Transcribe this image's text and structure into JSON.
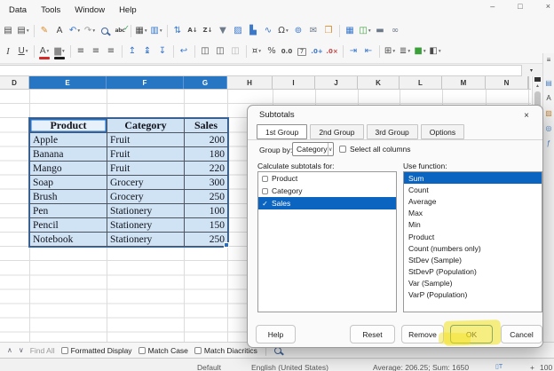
{
  "app": {
    "menu": [
      {
        "label": "Data"
      },
      {
        "label": "Tools"
      },
      {
        "label": "Window"
      },
      {
        "label": "Help"
      }
    ],
    "window_controls": [
      {
        "name": "minimize-button",
        "glyph": "–"
      },
      {
        "name": "maximize-button",
        "glyph": "□"
      },
      {
        "name": "close-button",
        "glyph": "×"
      }
    ]
  },
  "toolbar_main": [
    {
      "name": "copy-icon",
      "glyph": "▤"
    },
    {
      "name": "paste-icon",
      "glyph": "▤",
      "caret": true
    },
    {
      "sep": true
    },
    {
      "name": "clone-formatting-icon",
      "glyph": "✎",
      "color": "#d98b2b"
    },
    {
      "name": "clear-formatting-icon",
      "glyph": "A",
      "color": "#444"
    },
    {
      "name": "undo-icon",
      "glyph": "↶",
      "color": "#3b78c9",
      "caret": true
    },
    {
      "name": "redo-icon",
      "glyph": "↷",
      "color": "#9a9a9a",
      "caret": true
    },
    {
      "name": "find-replace-icon",
      "icon": "lens"
    },
    {
      "name": "spelling-icon",
      "glyph": "abc",
      "cls": "spell"
    },
    {
      "sep": true
    },
    {
      "name": "insert-row-icon",
      "glyph": "▦",
      "caret": true
    },
    {
      "name": "insert-column-icon",
      "glyph": "▥",
      "color": "#3b78c9",
      "caret": true
    },
    {
      "sep": true
    },
    {
      "name": "sort-icon",
      "glyph": "⇅",
      "color": "#3b78c9"
    },
    {
      "name": "sort-ascending-icon",
      "glyph": "A↓",
      "cls": "tiny"
    },
    {
      "name": "sort-descending-icon",
      "glyph": "Z↓",
      "cls": "tiny"
    },
    {
      "name": "autofilter-icon",
      "glyph": "▼",
      "color": "#6d7a8a"
    },
    {
      "name": "insert-image-icon",
      "glyph": "▨",
      "color": "#3b78c9"
    },
    {
      "name": "insert-chart-icon",
      "glyph": "▙",
      "color": "#3b78c9"
    },
    {
      "name": "sparkline-icon",
      "glyph": "∿",
      "color": "#3b78c9"
    },
    {
      "name": "special-character-icon",
      "glyph": "Ω",
      "caret": true
    },
    {
      "name": "hyperlink-icon",
      "glyph": "⊚",
      "color": "#3b78c9"
    },
    {
      "name": "comment-icon",
      "glyph": "✉",
      "color": "#6d7a8a"
    },
    {
      "name": "draft-page-icon",
      "glyph": "❒",
      "color": "#d98b2b"
    },
    {
      "sep": true
    },
    {
      "name": "pivot-table-icon",
      "glyph": "▦",
      "color": "#3b78c9"
    },
    {
      "name": "freeze-panes-icon",
      "glyph": "◫",
      "color": "#3aa13a",
      "caret": true
    },
    {
      "name": "split-window-icon",
      "glyph": "▬",
      "color": "#6d7a8a"
    },
    {
      "name": "shapes-icon",
      "glyph": "∞",
      "color": "#6d7a8a"
    }
  ],
  "toolbar_format": [
    {
      "name": "italic-icon",
      "glyph": "I",
      "cls": "ital"
    },
    {
      "name": "underline-icon",
      "glyph": "U",
      "cls": "und",
      "caret": true
    },
    {
      "sep": true
    },
    {
      "name": "font-color-icon",
      "glyph": "A",
      "bar": "#cf2b2b",
      "caret": true
    },
    {
      "name": "highlight-color-icon",
      "glyph": "▆",
      "color": "#8a8a8a",
      "bar": "#1a1a1a",
      "caret": true
    },
    {
      "sep": true
    },
    {
      "name": "align-left-icon",
      "glyph": "≡"
    },
    {
      "name": "align-center-icon",
      "glyph": "≡"
    },
    {
      "name": "align-right-icon",
      "glyph": "≡"
    },
    {
      "sep": true
    },
    {
      "name": "align-top-icon",
      "glyph": "↥",
      "color": "#3b78c9"
    },
    {
      "name": "center-vertically-icon",
      "glyph": "↨",
      "color": "#3b78c9"
    },
    {
      "name": "align-bottom-icon",
      "glyph": "↧",
      "color": "#3b78c9"
    },
    {
      "sep": true
    },
    {
      "name": "wrap-text-icon",
      "glyph": "↩",
      "color": "#3b78c9"
    },
    {
      "sep": true
    },
    {
      "name": "merge-center-icon",
      "glyph": "◫"
    },
    {
      "name": "merge-cells-icon",
      "glyph": "◫"
    },
    {
      "name": "unmerge-cells-icon",
      "glyph": "◫",
      "color": "#b5b5b5"
    },
    {
      "sep": true
    },
    {
      "name": "currency-format-icon",
      "glyph": "¤",
      "caret": true
    },
    {
      "name": "percent-format-icon",
      "glyph": "%"
    },
    {
      "name": "number-format-icon",
      "glyph": "0.0",
      "cls": "tiny"
    },
    {
      "name": "date-format-icon",
      "glyph": "7",
      "cls": "boxed"
    },
    {
      "name": "add-decimal-icon",
      "glyph": ".0+",
      "cls": "tiny",
      "color": "#3b78c9"
    },
    {
      "name": "delete-decimal-icon",
      "glyph": ".0×",
      "cls": "tiny",
      "color": "#c04a4a"
    },
    {
      "sep": true
    },
    {
      "name": "increase-indent-icon",
      "glyph": "⇥",
      "color": "#3b78c9"
    },
    {
      "name": "decrease-indent-icon",
      "glyph": "⇤",
      "color": "#3b78c9"
    },
    {
      "sep": true
    },
    {
      "name": "borders-icon",
      "glyph": "⊞",
      "caret": true
    },
    {
      "name": "border-style-icon",
      "glyph": "≣",
      "caret": true
    },
    {
      "name": "background-color-icon",
      "glyph": "■",
      "color": "#3aa13a",
      "caret": true
    },
    {
      "name": "conditional-formatting-icon",
      "glyph": "◧",
      "caret": true
    }
  ],
  "formula_bar": {
    "expand_glyph": "▾"
  },
  "columns": {
    "headers": [
      "D",
      "E",
      "F",
      "G",
      "H",
      "I",
      "J",
      "K",
      "L",
      "M",
      "N"
    ],
    "selected": [
      "E",
      "F",
      "G"
    ]
  },
  "table": {
    "headers": [
      "Product",
      "Category",
      "Sales"
    ],
    "rows": [
      [
        "Apple",
        "Fruit",
        "200"
      ],
      [
        "Banana",
        "Fruit",
        "180"
      ],
      [
        "Mango",
        "Fruit",
        "220"
      ],
      [
        "Soap",
        "Grocery",
        "300"
      ],
      [
        "Brush",
        "Grocery",
        "250"
      ],
      [
        "Pen",
        "Stationery",
        "100"
      ],
      [
        "Pencil",
        "Stationery",
        "150"
      ],
      [
        "Notebook",
        "Stationery",
        "250"
      ]
    ]
  },
  "scrollbar": {
    "up_glyph": "▲",
    "down_glyph": "▼"
  },
  "sidebar": {
    "icons": [
      {
        "name": "sidebar-settings-icon",
        "glyph": "≡",
        "color": "#444"
      },
      {
        "name": "properties-icon",
        "glyph": "▤",
        "color": "#4d82c4"
      },
      {
        "name": "styles-icon",
        "glyph": "A",
        "color": "#444"
      },
      {
        "name": "gallery-icon",
        "glyph": "▨",
        "color": "#c9893a"
      },
      {
        "name": "navigator-icon",
        "glyph": "◎",
        "color": "#4d82c4"
      },
      {
        "name": "functions-icon",
        "glyph": "ƒ",
        "color": "#4d82c4"
      }
    ]
  },
  "dialog": {
    "title": "Subtotals",
    "close_glyph": "×",
    "tabs": [
      {
        "label": "1st Group",
        "active": true
      },
      {
        "label": "2nd Group"
      },
      {
        "label": "3rd Group"
      },
      {
        "label": "Options"
      }
    ],
    "group_by_label": "Group by:",
    "group_by_value": "Category",
    "group_by_caret": "∨",
    "select_all_label": "Select all columns",
    "select_all_checked": false,
    "subtotals_label": "Calculate subtotals for:",
    "check_glyph": "✓",
    "subtotal_columns": [
      {
        "label": "Product",
        "checked": false
      },
      {
        "label": "Category",
        "checked": false
      },
      {
        "label": "Sales",
        "checked": true,
        "selected": true
      }
    ],
    "use_function_label": "Use function:",
    "functions": [
      {
        "label": "Sum",
        "selected": true
      },
      {
        "label": "Count"
      },
      {
        "label": "Average"
      },
      {
        "label": "Max"
      },
      {
        "label": "Min"
      },
      {
        "label": "Product"
      },
      {
        "label": "Count (numbers only)"
      },
      {
        "label": "StDev (Sample)"
      },
      {
        "label": "StDevP (Population)"
      },
      {
        "label": "Var (Sample)"
      },
      {
        "label": "VarP (Population)"
      }
    ],
    "buttons": {
      "help": "Help",
      "reset": "Reset",
      "remove": "Remove",
      "ok": "OK",
      "cancel": "Cancel"
    }
  },
  "find_bar": {
    "prev_glyph": "∧",
    "next_glyph": "∨",
    "find_all_label": "Find All",
    "checkboxes": [
      {
        "label": "Formatted Display",
        "checked": false
      },
      {
        "label": "Match Case",
        "checked": false
      },
      {
        "label": "Match Diacritics",
        "checked": false
      }
    ]
  },
  "status_bar": {
    "style_name": "Default",
    "language": "English (United States)",
    "selection_glyph": "▯T",
    "summary": "Average: 206.25; Sum: 1650",
    "zoom_plus": "+",
    "zoom_level": "100"
  },
  "colors": {
    "accent": "#0a64c0",
    "selected_header": "#2676c4",
    "selection_fill": "#cfe3f5",
    "highlight": "#f2e11c"
  }
}
